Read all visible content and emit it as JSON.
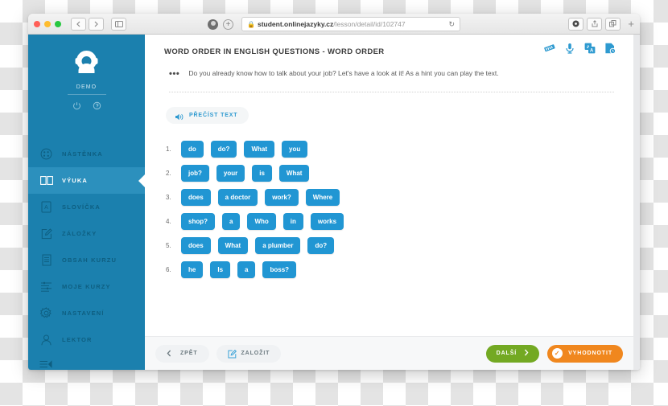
{
  "browser": {
    "url_domain": "student.onlinejazyky.cz",
    "url_path": "/lesson/detail/id/102747",
    "back_icon": "chevron-left-icon",
    "forward_icon": "chevron-right-icon",
    "sidebar_icon": "sidebar-toggle-icon",
    "lock_icon": "lock-icon",
    "reload_icon": "reload-icon",
    "new_tab_label": "+"
  },
  "sidebar": {
    "user_name": "DEMO",
    "power_icon": "power-icon",
    "help_icon": "help-icon",
    "collapse_icon": "collapse-menu-icon",
    "items": [
      {
        "label": "NÁSTĚNKA",
        "icon": "dashboard-icon",
        "active": false
      },
      {
        "label": "VÝUKA",
        "icon": "book-icon",
        "active": true
      },
      {
        "label": "SLOVÍČKA",
        "icon": "vocabulary-card-icon",
        "active": false
      },
      {
        "label": "ZÁLOŽKY",
        "icon": "bookmark-edit-icon",
        "active": false
      },
      {
        "label": "OBSAH KURZU",
        "icon": "course-content-icon",
        "active": false
      },
      {
        "label": "MOJE KURZY",
        "icon": "my-courses-icon",
        "active": false
      },
      {
        "label": "NASTAVENÍ",
        "icon": "gear-icon",
        "active": false
      },
      {
        "label": "LEKTOR",
        "icon": "user-icon",
        "active": false
      }
    ]
  },
  "lesson": {
    "title": "WORD ORDER IN ENGLISH QUESTIONS - WORD ORDER",
    "header_icons": [
      {
        "name": "flashcards-icon"
      },
      {
        "name": "microphone-icon"
      },
      {
        "name": "translate-icon"
      },
      {
        "name": "notes-icon"
      }
    ],
    "bullet": "•••",
    "intro_text": "Do you already know how to talk about your job? Let's have a look at it! As a hint you can play the text.",
    "read_button": {
      "label": "PŘEČÍST TEXT",
      "icon": "speaker-icon"
    },
    "rows": [
      {
        "num": "1.",
        "tiles": [
          "do",
          "do?",
          "What",
          "you"
        ]
      },
      {
        "num": "2.",
        "tiles": [
          "job?",
          "your",
          "is",
          "What"
        ]
      },
      {
        "num": "3.",
        "tiles": [
          "does",
          "a doctor",
          "work?",
          "Where"
        ]
      },
      {
        "num": "4.",
        "tiles": [
          "shop?",
          "a",
          "Who",
          "in",
          "works"
        ]
      },
      {
        "num": "5.",
        "tiles": [
          "does",
          "What",
          "a plumber",
          "do?"
        ]
      },
      {
        "num": "6.",
        "tiles": [
          "he",
          "Is",
          "a",
          "boss?"
        ]
      }
    ]
  },
  "footer": {
    "back_label": "ZPĚT",
    "back_icon": "chevron-left-icon",
    "bookmark_label": "ZALOŽIT",
    "bookmark_icon": "bookmark-add-icon",
    "next_label": "DALŠÍ",
    "next_icon": "chevron-right-icon",
    "evaluate_label": "VYHODNOTIT",
    "evaluate_icon": "check-circle-icon"
  },
  "colors": {
    "sidebar": "#1b80ae",
    "sidebar_active": "#2c90bd",
    "tile_blue": "#2196d3",
    "accent_blue": "#2e9ad0",
    "next_green": "#73a923",
    "evaluate_orange": "#f0871e"
  }
}
